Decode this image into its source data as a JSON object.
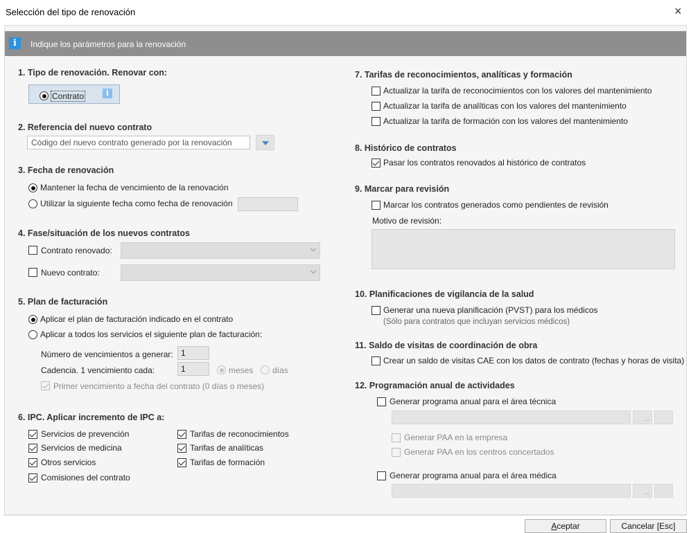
{
  "window": {
    "title": "Selección del tipo de renovación",
    "close_glyph": "×"
  },
  "banner": {
    "icon": "info-icon",
    "icon_glyph": "i",
    "text": "Indique los parámetros para la renovación"
  },
  "s1": {
    "title": "1. Tipo de renovación. Renovar con:",
    "option": "Contrato",
    "info_glyph": "i"
  },
  "s2": {
    "title": "2. Referencia del nuevo contrato",
    "value": "Código del nuevo contrato generado por la renovación"
  },
  "s3": {
    "title": "3. Fecha de renovación",
    "opt_keep": "Mantener la fecha de vencimiento de la renovación",
    "opt_use": "Utilizar la siguiente fecha como fecha de renovación",
    "date_value": ""
  },
  "s4": {
    "title": "4. Fase/situación de los nuevos contratos",
    "renewed_label": "Contrato renovado:",
    "new_label": "Nuevo contrato:"
  },
  "s5": {
    "title": "5. Plan de facturación",
    "opt_contract": "Aplicar el plan de facturación indicado en el contrato",
    "opt_all": "Aplicar a todos los servicios el siguiente plan de facturación:",
    "count_label": "Número de vencimientos a generar:",
    "count_value": "1",
    "cadence_label": "Cadencia. 1 vencimiento cada:",
    "cadence_value": "1",
    "meses": "meses",
    "dias": "días",
    "first_due": "Primer vencimiento a fecha del contrato (0 días o meses)"
  },
  "s6": {
    "title": "6. IPC. Aplicar incremento de IPC a:",
    "col1": [
      "Servicios de prevención",
      "Servicios de medicina",
      "Otros servicios",
      "Comisiones del contrato"
    ],
    "col2": [
      "Tarifas de reconocimientos",
      "Tarifas de analíticas",
      "Tarifas de formación"
    ]
  },
  "s7": {
    "title": "7. Tarifas de reconocimientos, analíticas y formación",
    "items": [
      "Actualizar la tarifa de reconocimientos con los valores del mantenimiento",
      "Actualizar la tarifa de analíticas con los valores del mantenimiento",
      "Actualizar la tarifa de formación con los valores del mantenimiento"
    ]
  },
  "s8": {
    "title": "8. Histórico de contratos",
    "item": "Pasar los contratos renovados al histórico de contratos"
  },
  "s9": {
    "title": "9. Marcar para revisión",
    "item": "Marcar los contratos generados como pendientes de revisión",
    "motivo_label": "Motivo de revisión:"
  },
  "s10": {
    "title": "10. Planificaciones de vigilancia de la salud",
    "item": "Generar una nueva planificación (PVST) para los médicos",
    "note": "(Sólo para contratos que incluyan servicios médicos)"
  },
  "s11": {
    "title": "11. Saldo de visitas de coordinación de obra",
    "item": "Crear un saldo de visitas CAE con los datos de contrato (fechas y horas de visita)"
  },
  "s12": {
    "title": "12. Programación anual de actividades",
    "tech": "Generar programa anual para el área técnica",
    "paa_company": "Generar PAA en la empresa",
    "paa_centers": "Generar PAA en los centros concertados",
    "med": "Generar programa anual para el área médica",
    "ellipsis": "..."
  },
  "buttons": {
    "accept_first": "A",
    "accept_rest": "ceptar",
    "cancel": "Cancelar [Esc]"
  }
}
